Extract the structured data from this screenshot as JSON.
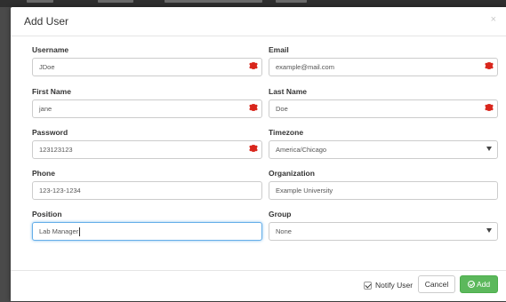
{
  "modal": {
    "title": "Add User",
    "close_label": "×"
  },
  "fields": {
    "username": {
      "label": "Username",
      "value": "JDoe",
      "required": true
    },
    "email": {
      "label": "Email",
      "value": "example@mail.com",
      "required": true
    },
    "first_name": {
      "label": "First Name",
      "value": "jane",
      "required": true
    },
    "last_name": {
      "label": "Last Name",
      "value": "Doe",
      "required": true
    },
    "password": {
      "label": "Password",
      "value": "123123123",
      "required": true
    },
    "timezone": {
      "label": "Timezone",
      "value": "America/Chicago"
    },
    "phone": {
      "label": "Phone",
      "value": "123-123-1234"
    },
    "organization": {
      "label": "Organization",
      "value": "Example University"
    },
    "position": {
      "label": "Position",
      "value": "Lab Manager"
    },
    "group": {
      "label": "Group",
      "value": "None"
    }
  },
  "footer": {
    "notify_label": "Notify User",
    "notify_checked": true,
    "cancel_label": "Cancel",
    "add_label": "Add"
  },
  "colors": {
    "primary_green": "#5cb85c",
    "required_red": "#d9261c",
    "focus_blue": "#66afe9"
  },
  "icons": {
    "required": "asterisk-icon",
    "add": "check-circle-icon",
    "select": "caret-down-icon",
    "close": "close-icon"
  }
}
